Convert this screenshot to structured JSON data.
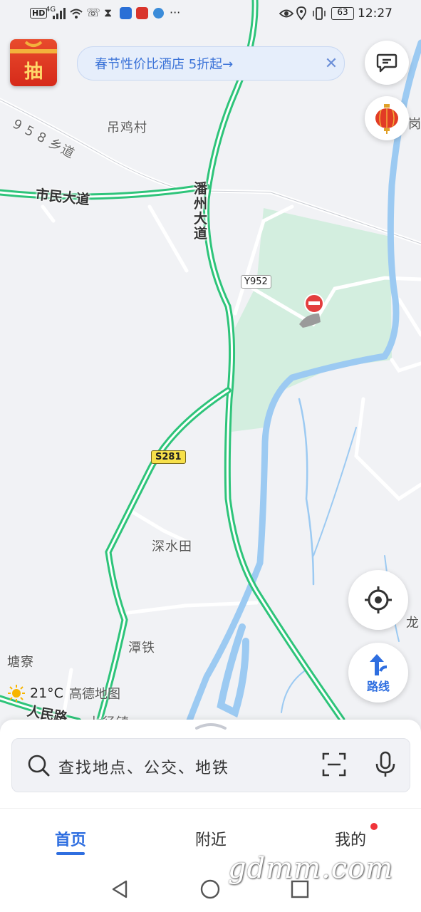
{
  "status_bar": {
    "left_label": "HD",
    "signal_label": "4G",
    "battery_level": "63",
    "time": "12:27"
  },
  "promo": {
    "button_char": "抽",
    "banner_text": "春节性价比酒店 5折起→"
  },
  "map": {
    "labels": {
      "village_diaoji": "吊鸡村",
      "road_958": "9 5 8 乡道",
      "road_shimin": "市民大道",
      "road_panzhou": "潘州大道",
      "shield_y952": "Y952",
      "shield_s281": "S281",
      "place_shenshuitian": "深水田",
      "place_tantie": "潭铁",
      "place_tangliao": "塘寮",
      "road_renmin": "人民路",
      "place_partial_right_top": "岗",
      "place_partial_right_bottom": "龙",
      "place_partial_bottom": "七径镇"
    },
    "colors": {
      "road_green": "#2ec47a",
      "water_blue": "#9ccaf2",
      "park_green": "#d6efe2"
    }
  },
  "buttons": {
    "route_label": "路线"
  },
  "weather": {
    "temperature": "21°C",
    "brand": "高德地图"
  },
  "search": {
    "placeholder": "查找地点、公交、地铁"
  },
  "tabs": [
    {
      "label": "首页",
      "active": true
    },
    {
      "label": "附近",
      "active": false
    },
    {
      "label": "我的",
      "active": false,
      "has_badge": true
    }
  ],
  "watermark": "gdmm.com"
}
